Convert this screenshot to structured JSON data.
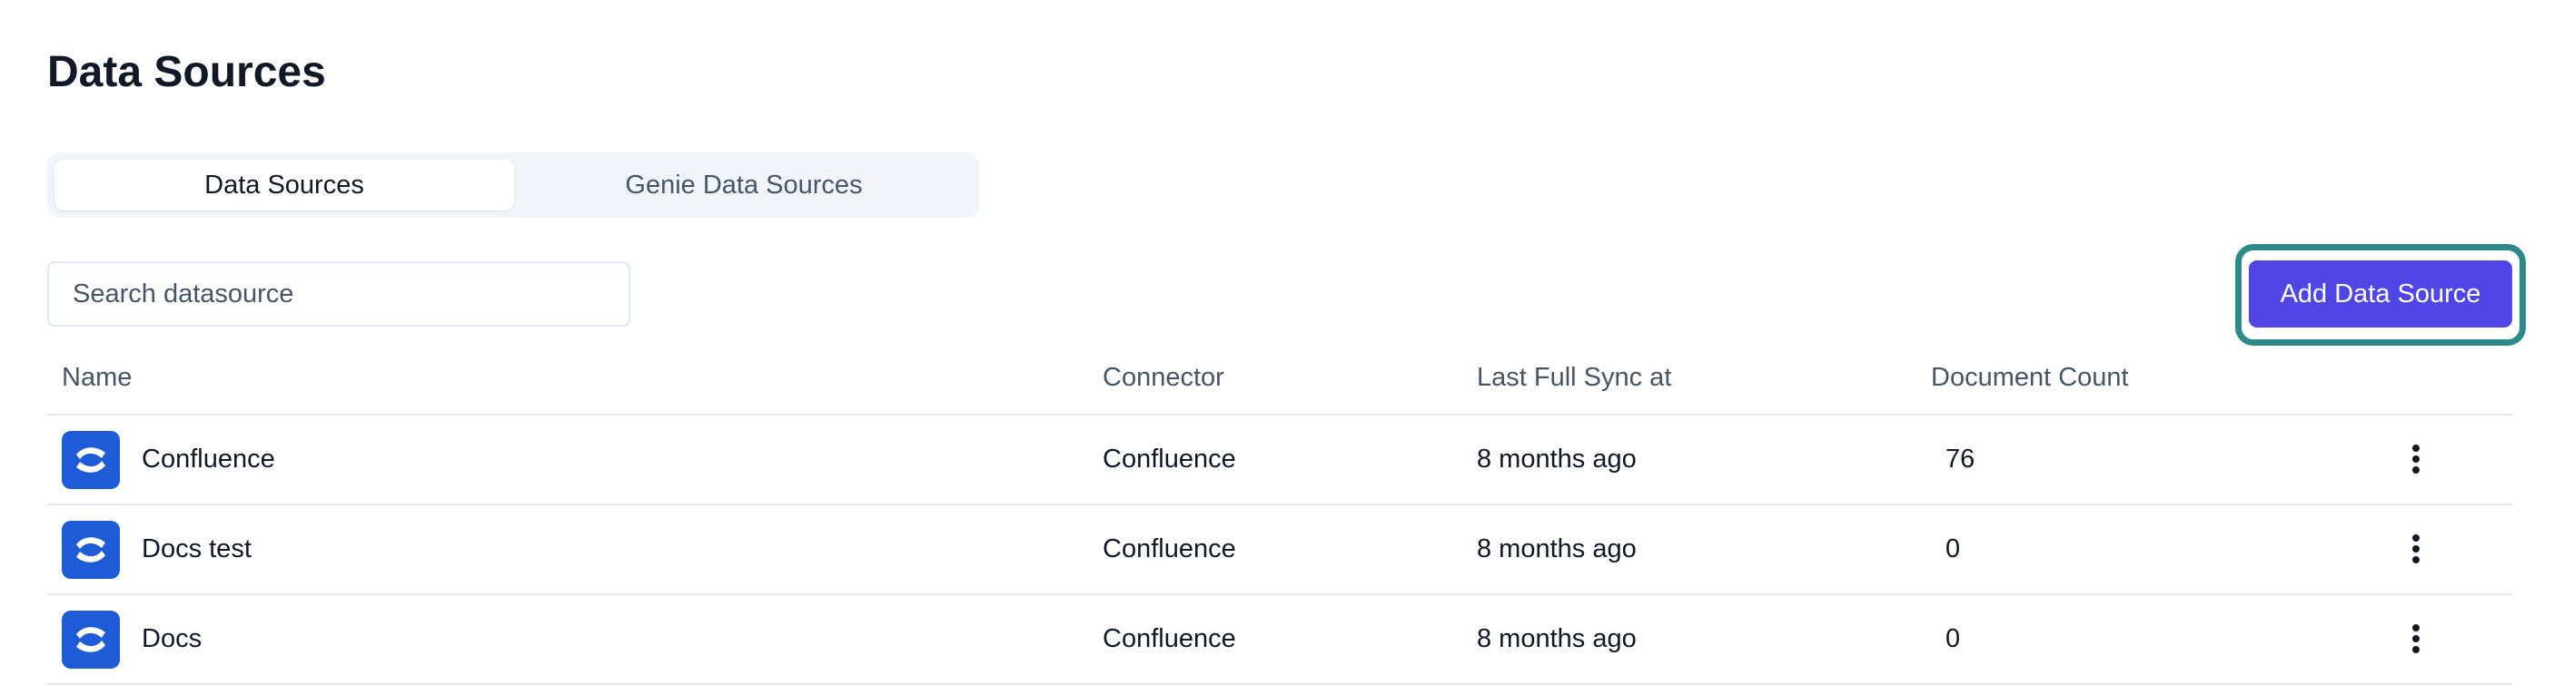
{
  "page": {
    "title": "Data Sources"
  },
  "tabs": [
    {
      "label": "Data Sources",
      "active": true
    },
    {
      "label": "Genie Data Sources",
      "active": false
    }
  ],
  "search": {
    "placeholder": "Search datasource",
    "value": ""
  },
  "toolbar": {
    "add_label": "Add Data Source"
  },
  "table": {
    "columns": [
      "Name",
      "Connector",
      "Last Full Sync at",
      "Document Count"
    ],
    "rows": [
      {
        "icon": "confluence-icon",
        "name": "Confluence",
        "connector": "Confluence",
        "last_sync": "8 months ago",
        "doc_count": "76"
      },
      {
        "icon": "confluence-icon",
        "name": "Docs test",
        "connector": "Confluence",
        "last_sync": "8 months ago",
        "doc_count": "0"
      },
      {
        "icon": "confluence-icon",
        "name": "Docs",
        "connector": "Confluence",
        "last_sync": "8 months ago",
        "doc_count": "0"
      }
    ]
  },
  "colors": {
    "accent": "#4f46e5",
    "highlight": "#2e8a8a",
    "confluence": "#1e5bd6"
  }
}
